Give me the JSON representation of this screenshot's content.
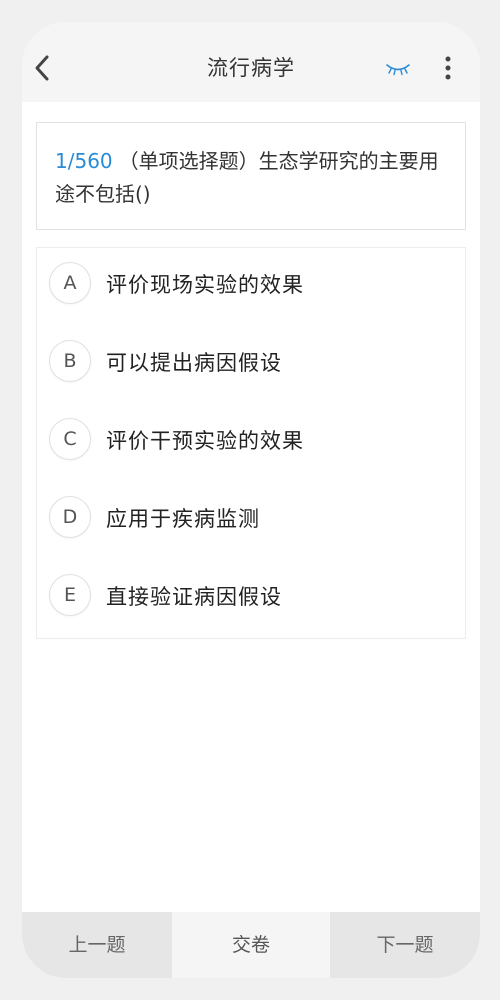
{
  "header": {
    "title": "流行病学",
    "accent_color": "#2a8bd6"
  },
  "question": {
    "number": "1/560",
    "type_label": "（单项选择题）",
    "text": "生态学研究的主要用途不包括()"
  },
  "options": [
    {
      "letter": "A",
      "text": "评价现场实验的效果"
    },
    {
      "letter": "B",
      "text": "可以提出病因假设"
    },
    {
      "letter": "C",
      "text": "评价干预实验的效果"
    },
    {
      "letter": "D",
      "text": "应用于疾病监测"
    },
    {
      "letter": "E",
      "text": "直接验证病因假设"
    }
  ],
  "bottom": {
    "prev_label": "上一题",
    "submit_label": "交卷",
    "next_label": "下一题"
  },
  "icons": {
    "back": "chevron-left-icon",
    "eye": "eye-closed-icon",
    "more": "more-vertical-icon"
  }
}
